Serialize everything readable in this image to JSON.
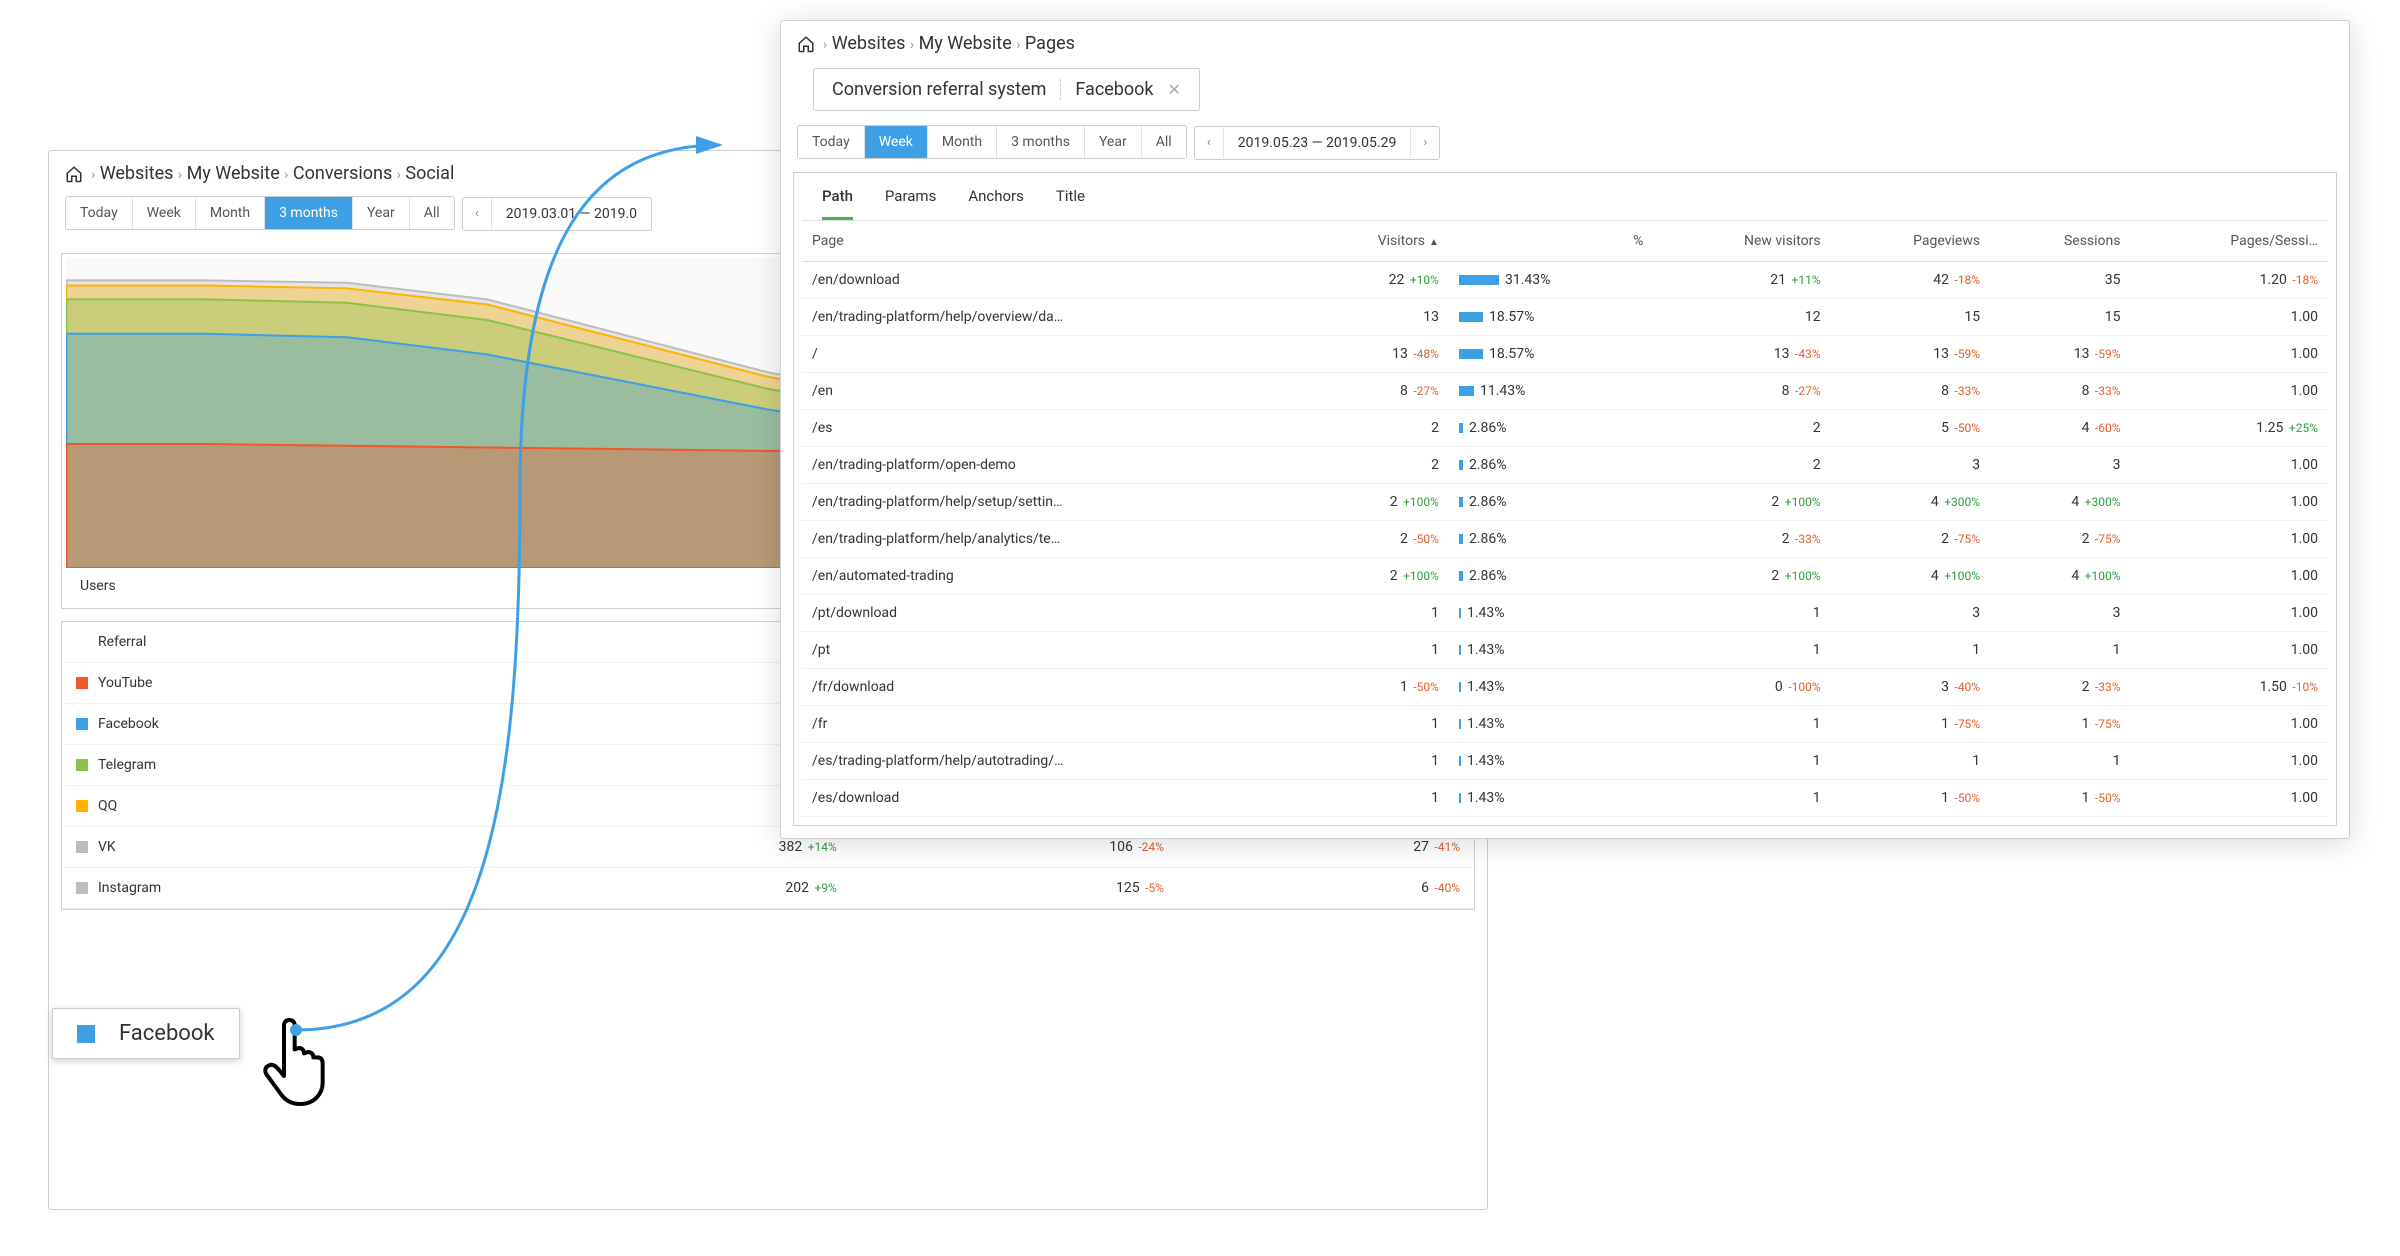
{
  "left": {
    "breadcrumb": [
      "Websites",
      "My Website",
      "Conversions",
      "Social"
    ],
    "periods": [
      "Today",
      "Week",
      "Month",
      "3 months",
      "Year",
      "All"
    ],
    "activePeriod": "3 months",
    "dateRange": "2019.03.01 — 2019.0",
    "chartLabel": "Users",
    "referralHeader": "Referral",
    "referrals": [
      {
        "name": "YouTube",
        "color": "#f0572c"
      },
      {
        "name": "Facebook",
        "color": "#3da0e6"
      },
      {
        "name": "Telegram",
        "color": "#8bc34a"
      },
      {
        "name": "QQ",
        "color": "#ffb300"
      },
      {
        "name": "VK",
        "color": "#bdbdbd",
        "v1": "382",
        "d1": "+14%",
        "v2": "106",
        "d2": "-24%",
        "v3": "27",
        "d3": "-41%"
      },
      {
        "name": "Instagram",
        "color": "#bdbdbd",
        "v1": "202",
        "d1": "+9%",
        "v2": "125",
        "d2": "-5%",
        "v3": "6",
        "d3": "-40%"
      }
    ],
    "fbPopup": "Facebook"
  },
  "right": {
    "breadcrumb": [
      "Websites",
      "My Website",
      "Pages"
    ],
    "filterLabel": "Conversion referral system",
    "filterValue": "Facebook",
    "periods": [
      "Today",
      "Week",
      "Month",
      "3 months",
      "Year",
      "All"
    ],
    "activePeriod": "Week",
    "dateRange": "2019.05.23 — 2019.05.29",
    "tabs": [
      "Path",
      "Params",
      "Anchors",
      "Title"
    ],
    "activeTab": "Path",
    "columns": [
      "Page",
      "Visitors",
      "%",
      "New visitors",
      "Pageviews",
      "Sessions",
      "Pages/Sessi…"
    ],
    "rows": [
      {
        "page": "/en/download",
        "visitors": "22",
        "vDelta": "+10%",
        "pct": "31.43%",
        "pctW": 40,
        "nv": "21",
        "nvDelta": "+11%",
        "pv": "42",
        "pvDelta": "-18%",
        "sess": "35",
        "sessDelta": "",
        "ps": "1.20",
        "psDelta": "-18%"
      },
      {
        "page": "/en/trading-platform/help/overview/da…",
        "visitors": "13",
        "vDelta": "",
        "pct": "18.57%",
        "pctW": 24,
        "nv": "12",
        "nvDelta": "",
        "pv": "15",
        "pvDelta": "",
        "sess": "15",
        "sessDelta": "",
        "ps": "1.00",
        "psDelta": ""
      },
      {
        "page": "/",
        "visitors": "13",
        "vDelta": "-48%",
        "pct": "18.57%",
        "pctW": 24,
        "nv": "13",
        "nvDelta": "-43%",
        "pv": "13",
        "pvDelta": "-59%",
        "sess": "13",
        "sessDelta": "-59%",
        "ps": "1.00",
        "psDelta": ""
      },
      {
        "page": "/en",
        "visitors": "8",
        "vDelta": "-27%",
        "pct": "11.43%",
        "pctW": 15,
        "nv": "8",
        "nvDelta": "-27%",
        "pv": "8",
        "pvDelta": "-33%",
        "sess": "8",
        "sessDelta": "-33%",
        "ps": "1.00",
        "psDelta": ""
      },
      {
        "page": "/es",
        "visitors": "2",
        "vDelta": "",
        "pct": "2.86%",
        "pctW": 4,
        "nv": "2",
        "nvDelta": "",
        "pv": "5",
        "pvDelta": "-50%",
        "sess": "4",
        "sessDelta": "-60%",
        "ps": "1.25",
        "psDelta": "+25%"
      },
      {
        "page": "/en/trading-platform/open-demo",
        "visitors": "2",
        "vDelta": "",
        "pct": "2.86%",
        "pctW": 4,
        "nv": "2",
        "nvDelta": "",
        "pv": "3",
        "pvDelta": "",
        "sess": "3",
        "sessDelta": "",
        "ps": "1.00",
        "psDelta": ""
      },
      {
        "page": "/en/trading-platform/help/setup/settin…",
        "visitors": "2",
        "vDelta": "+100%",
        "pct": "2.86%",
        "pctW": 4,
        "nv": "2",
        "nvDelta": "+100%",
        "pv": "4",
        "pvDelta": "+300%",
        "sess": "4",
        "sessDelta": "+300%",
        "ps": "1.00",
        "psDelta": ""
      },
      {
        "page": "/en/trading-platform/help/analytics/te…",
        "visitors": "2",
        "vDelta": "-50%",
        "pct": "2.86%",
        "pctW": 4,
        "nv": "2",
        "nvDelta": "-33%",
        "pv": "2",
        "pvDelta": "-75%",
        "sess": "2",
        "sessDelta": "-75%",
        "ps": "1.00",
        "psDelta": ""
      },
      {
        "page": "/en/automated-trading",
        "visitors": "2",
        "vDelta": "+100%",
        "pct": "2.86%",
        "pctW": 4,
        "nv": "2",
        "nvDelta": "+100%",
        "pv": "4",
        "pvDelta": "+100%",
        "sess": "4",
        "sessDelta": "+100%",
        "ps": "1.00",
        "psDelta": ""
      },
      {
        "page": "/pt/download",
        "visitors": "1",
        "vDelta": "",
        "pct": "1.43%",
        "pctW": 2,
        "nv": "1",
        "nvDelta": "",
        "pv": "3",
        "pvDelta": "",
        "sess": "3",
        "sessDelta": "",
        "ps": "1.00",
        "psDelta": ""
      },
      {
        "page": "/pt",
        "visitors": "1",
        "vDelta": "",
        "pct": "1.43%",
        "pctW": 2,
        "nv": "1",
        "nvDelta": "",
        "pv": "1",
        "pvDelta": "",
        "sess": "1",
        "sessDelta": "",
        "ps": "1.00",
        "psDelta": ""
      },
      {
        "page": "/fr/download",
        "visitors": "1",
        "vDelta": "-50%",
        "pct": "1.43%",
        "pctW": 2,
        "nv": "0",
        "nvDelta": "-100%",
        "pv": "3",
        "pvDelta": "-40%",
        "sess": "2",
        "sessDelta": "-33%",
        "ps": "1.50",
        "psDelta": "-10%"
      },
      {
        "page": "/fr",
        "visitors": "1",
        "vDelta": "",
        "pct": "1.43%",
        "pctW": 2,
        "nv": "1",
        "nvDelta": "",
        "pv": "1",
        "pvDelta": "-75%",
        "sess": "1",
        "sessDelta": "-75%",
        "ps": "1.00",
        "psDelta": ""
      },
      {
        "page": "/es/trading-platform/help/autotrading/…",
        "visitors": "1",
        "vDelta": "",
        "pct": "1.43%",
        "pctW": 2,
        "nv": "1",
        "nvDelta": "",
        "pv": "1",
        "pvDelta": "",
        "sess": "1",
        "sessDelta": "",
        "ps": "1.00",
        "psDelta": ""
      },
      {
        "page": "/es/download",
        "visitors": "1",
        "vDelta": "",
        "pct": "1.43%",
        "pctW": 2,
        "nv": "1",
        "nvDelta": "",
        "pv": "1",
        "pvDelta": "-50%",
        "sess": "1",
        "sessDelta": "-50%",
        "ps": "1.00",
        "psDelta": ""
      }
    ]
  },
  "chart_data": {
    "type": "area",
    "title": "Users",
    "series": [
      {
        "name": "YouTube",
        "color": "#f0572c",
        "values": [
          360,
          360,
          355,
          350,
          345,
          340,
          338,
          336,
          335,
          334,
          333
        ]
      },
      {
        "name": "Facebook",
        "color": "#3da0e6",
        "values": [
          680,
          680,
          670,
          620,
          540,
          460,
          400,
          370,
          360,
          355,
          352
        ]
      },
      {
        "name": "Telegram",
        "color": "#8bc34a",
        "values": [
          780,
          780,
          770,
          720,
          620,
          520,
          450,
          410,
          395,
          388,
          384
        ]
      },
      {
        "name": "QQ",
        "color": "#ffb300",
        "values": [
          820,
          820,
          812,
          765,
          660,
          555,
          480,
          438,
          420,
          412,
          408
        ]
      },
      {
        "name": "VK",
        "color": "#bdbdbd",
        "values": [
          835,
          835,
          828,
          780,
          674,
          568,
          492,
          450,
          432,
          424,
          420
        ]
      }
    ],
    "ylim": [
      0,
      900
    ]
  }
}
